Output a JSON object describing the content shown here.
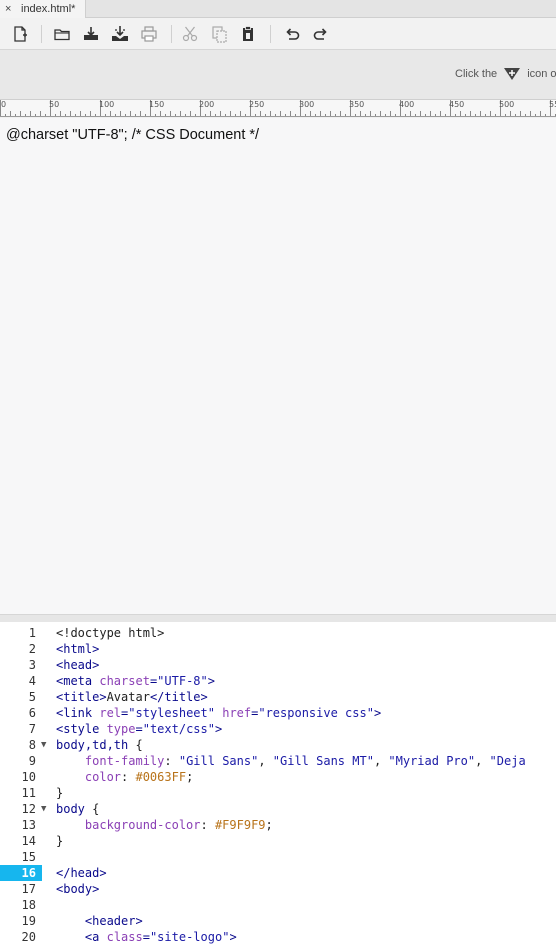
{
  "tab": {
    "close": "×",
    "label": "index.html*"
  },
  "toolbar": {
    "icons": [
      "new-file-icon",
      "open-folder-icon",
      "save-icon",
      "save-all-icon",
      "print-icon",
      "cut-icon",
      "copy-icon",
      "paste-icon",
      "undo-icon",
      "redo-icon"
    ]
  },
  "hint": {
    "prefix": "Click the",
    "suffix": "icon o"
  },
  "ruler": {
    "labels": [
      "0",
      "50",
      "100",
      "150",
      "200",
      "250",
      "300",
      "350",
      "400",
      "450",
      "500",
      "55"
    ]
  },
  "design": {
    "text": "@charset \"UTF-8\"; /* CSS Document */"
  },
  "code": {
    "active_line": "16",
    "lines": [
      {
        "num": "1",
        "fold": "",
        "tokens": [
          {
            "c": "t-plain",
            "t": "<!doctype html>"
          }
        ]
      },
      {
        "num": "2",
        "fold": "",
        "tokens": [
          {
            "c": "t-tag",
            "t": "<html>"
          }
        ]
      },
      {
        "num": "3",
        "fold": "",
        "tokens": [
          {
            "c": "t-tag",
            "t": "<head>"
          }
        ]
      },
      {
        "num": "4",
        "fold": "",
        "tokens": [
          {
            "c": "t-tag",
            "t": "<meta "
          },
          {
            "c": "t-attr",
            "t": "charset"
          },
          {
            "c": "t-tag",
            "t": "="
          },
          {
            "c": "t-str",
            "t": "\"UTF-8\""
          },
          {
            "c": "t-tag",
            "t": ">"
          }
        ]
      },
      {
        "num": "5",
        "fold": "",
        "tokens": [
          {
            "c": "t-tag",
            "t": "<title>"
          },
          {
            "c": "t-plain",
            "t": "Avatar"
          },
          {
            "c": "t-tag",
            "t": "</title>"
          }
        ]
      },
      {
        "num": "6",
        "fold": "",
        "tokens": [
          {
            "c": "t-tag",
            "t": "<link "
          },
          {
            "c": "t-attr",
            "t": "rel"
          },
          {
            "c": "t-tag",
            "t": "="
          },
          {
            "c": "t-str",
            "t": "\"stylesheet\""
          },
          {
            "c": "t-tag",
            "t": " "
          },
          {
            "c": "t-attr",
            "t": "href"
          },
          {
            "c": "t-tag",
            "t": "="
          },
          {
            "c": "t-str",
            "t": "\"responsive css\""
          },
          {
            "c": "t-tag",
            "t": ">"
          }
        ]
      },
      {
        "num": "7",
        "fold": "",
        "tokens": [
          {
            "c": "t-tag",
            "t": "<style "
          },
          {
            "c": "t-attr",
            "t": "type"
          },
          {
            "c": "t-tag",
            "t": "="
          },
          {
            "c": "t-str",
            "t": "\"text/css\""
          },
          {
            "c": "t-tag",
            "t": ">"
          }
        ]
      },
      {
        "num": "8",
        "fold": "▼",
        "tokens": [
          {
            "c": "t-sel",
            "t": "body,td,th "
          },
          {
            "c": "t-plain",
            "t": "{"
          }
        ]
      },
      {
        "num": "9",
        "fold": "",
        "tokens": [
          {
            "c": "t-plain",
            "t": "    "
          },
          {
            "c": "t-prop",
            "t": "font-family"
          },
          {
            "c": "t-plain",
            "t": ": "
          },
          {
            "c": "t-str",
            "t": "\"Gill Sans\""
          },
          {
            "c": "t-plain",
            "t": ", "
          },
          {
            "c": "t-str",
            "t": "\"Gill Sans MT\""
          },
          {
            "c": "t-plain",
            "t": ", "
          },
          {
            "c": "t-str",
            "t": "\"Myriad Pro\""
          },
          {
            "c": "t-plain",
            "t": ", "
          },
          {
            "c": "t-str",
            "t": "\"Deja"
          }
        ]
      },
      {
        "num": "10",
        "fold": "",
        "tokens": [
          {
            "c": "t-plain",
            "t": "    "
          },
          {
            "c": "t-prop",
            "t": "color"
          },
          {
            "c": "t-plain",
            "t": ": "
          },
          {
            "c": "t-hex",
            "t": "#0063FF"
          },
          {
            "c": "t-plain",
            "t": ";"
          }
        ]
      },
      {
        "num": "11",
        "fold": "",
        "tokens": [
          {
            "c": "t-plain",
            "t": "}"
          }
        ]
      },
      {
        "num": "12",
        "fold": "▼",
        "tokens": [
          {
            "c": "t-sel",
            "t": "body "
          },
          {
            "c": "t-plain",
            "t": "{"
          }
        ]
      },
      {
        "num": "13",
        "fold": "",
        "tokens": [
          {
            "c": "t-plain",
            "t": "    "
          },
          {
            "c": "t-prop",
            "t": "background-color"
          },
          {
            "c": "t-plain",
            "t": ": "
          },
          {
            "c": "t-hex",
            "t": "#F9F9F9"
          },
          {
            "c": "t-plain",
            "t": ";"
          }
        ]
      },
      {
        "num": "14",
        "fold": "",
        "tokens": [
          {
            "c": "t-plain",
            "t": "}"
          }
        ]
      },
      {
        "num": "15",
        "fold": "",
        "tokens": []
      },
      {
        "num": "16",
        "fold": "",
        "tokens": [
          {
            "c": "t-tag",
            "t": "</head>"
          }
        ]
      },
      {
        "num": "17",
        "fold": "",
        "tokens": [
          {
            "c": "t-tag",
            "t": "<body>"
          }
        ]
      },
      {
        "num": "18",
        "fold": "",
        "tokens": []
      },
      {
        "num": "19",
        "fold": "",
        "tokens": [
          {
            "c": "t-plain",
            "t": "    "
          },
          {
            "c": "t-tag",
            "t": "<header>"
          }
        ]
      },
      {
        "num": "20",
        "fold": "",
        "tokens": [
          {
            "c": "t-plain",
            "t": "    "
          },
          {
            "c": "t-tag",
            "t": "<a "
          },
          {
            "c": "t-attr",
            "t": "class"
          },
          {
            "c": "t-tag",
            "t": "="
          },
          {
            "c": "t-str",
            "t": "\"site-logo\""
          },
          {
            "c": "t-tag",
            "t": ">"
          }
        ]
      }
    ]
  }
}
